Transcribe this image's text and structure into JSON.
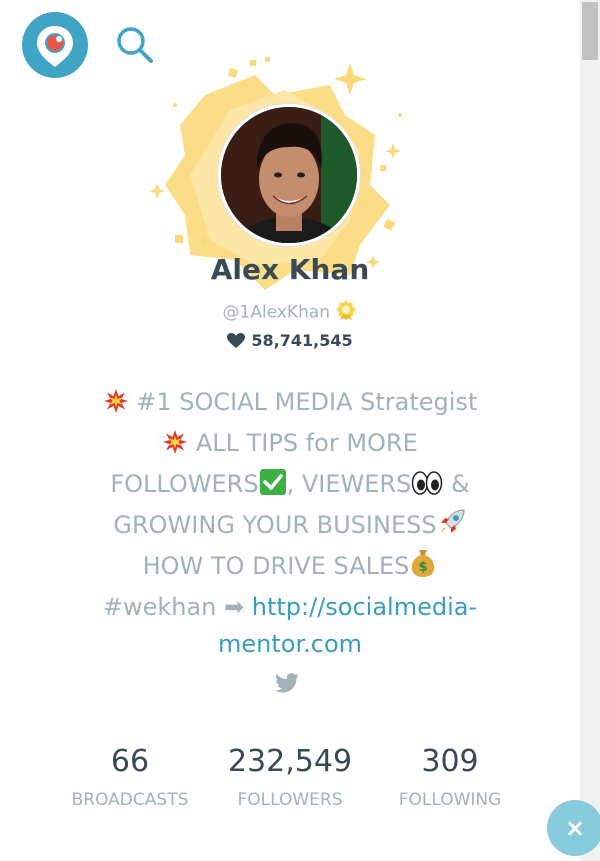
{
  "colors": {
    "brand": "#40a4c4",
    "link": "#3a9dbd",
    "muted_text": "#a3b2b9",
    "dark_text": "#3a4a55",
    "burst": "#fbd97a",
    "close_button": "#86cadb"
  },
  "header": {
    "logo_icon": "periscope-logo-icon",
    "search_icon": "search-icon"
  },
  "profile": {
    "name": "Alex Khan",
    "handle": "@1AlexKhan",
    "verified_icon": "superfan-badge-icon",
    "hearts": "58,741,545"
  },
  "bio": {
    "line1": "#1 SOCIAL MEDIA Strategist",
    "line2": "ALL TIPS for MORE",
    "line3a": "FOLLOWERS",
    "line3b": ", VIEWERS",
    "line3c": " &",
    "line4": "GROWING YOUR BUSINESS",
    "line5": "HOW TO DRIVE SALES",
    "line6_tag": "#wekhan ➡ ",
    "link_part1": "http://socialmedia-",
    "link_part2": "mentor.com"
  },
  "stats": [
    {
      "value": "66",
      "label": "BROADCASTS"
    },
    {
      "value": "232,549",
      "label": "FOLLOWERS"
    },
    {
      "value": "309",
      "label": "FOLLOWING"
    }
  ],
  "close_label": "×"
}
